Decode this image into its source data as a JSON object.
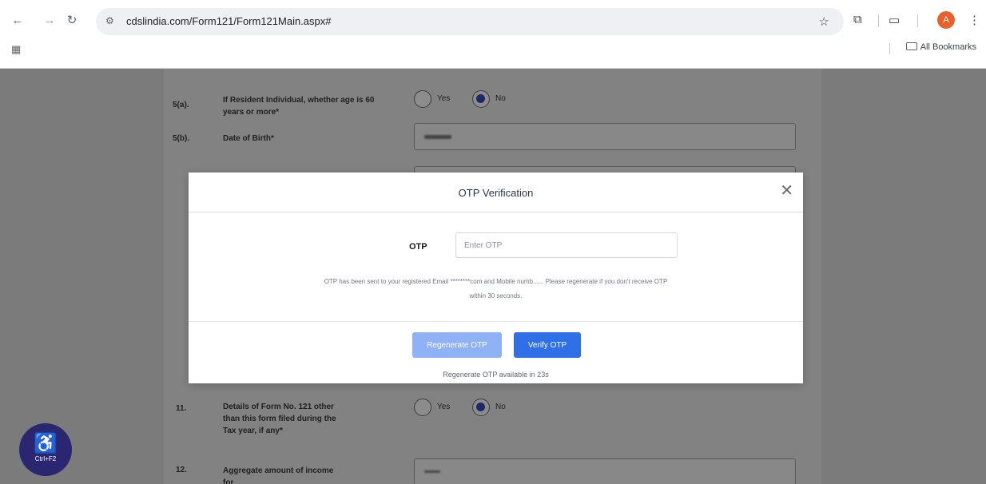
{
  "browser": {
    "url": "cdslindia.com/Form121/Form121Main.aspx#",
    "bookmarks_label": "All Bookmarks",
    "profile_initial": "A"
  },
  "form": {
    "rows": [
      {
        "num": "5(a).",
        "label": "If Resident Individual, whether age is 60 years or more*",
        "opt_yes": "Yes",
        "opt_no": "No"
      },
      {
        "num": "5(b).",
        "label": "Date of Birth*"
      },
      {
        "num": "11.",
        "label": "Details of Form No. 121 other than this form filed during the Tax year, if any*",
        "opt_yes": "Yes",
        "opt_no": "No"
      },
      {
        "num": "12.",
        "label": "Aggregate amount of income for"
      }
    ]
  },
  "accessibility": {
    "shortcut": "Ctrl+F2"
  },
  "modal": {
    "title": "OTP Verification",
    "otp_label": "OTP",
    "otp_placeholder": "Enter OTP",
    "otp_value": "",
    "message_line1": "OTP has been sent to your registered Email ********com and Mobile numb...... Please regenerate if you don't receive OTP",
    "message_line2": "within 30 seconds.",
    "regenerate_label": "Regenerate OTP",
    "verify_label": "Verify OTP",
    "regen_note": "Regenerate OTP available in 23s"
  },
  "colors": {
    "accent": "#2f6fe8",
    "accent_disabled": "#8fb1f5",
    "overlay": "#7b7b7b",
    "accessibility_button": "#2a2770"
  }
}
